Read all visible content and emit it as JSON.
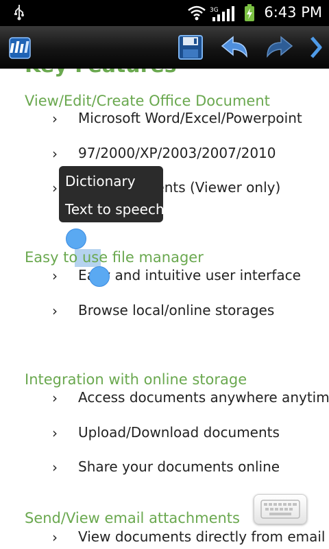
{
  "status_bar": {
    "time": "6:43 PM"
  },
  "toolbar": {
    "app_icon": "office-app-icon",
    "save_icon": "save-icon",
    "undo_icon": "undo-icon",
    "redo_icon": "redo-icon",
    "more_icon": "chevron-right-icon"
  },
  "document": {
    "top_heading_partial": "Key Features",
    "sections": [
      {
        "heading": "View/Edit/Create Office Document",
        "items": [
          "Microsoft Word/Excel/Powerpoint",
          "97/2000/XP/2003/2007/2010",
          "PDF documents (Viewer only)"
        ]
      },
      {
        "heading_before": "Easy to ",
        "heading_selected": "use",
        "heading_after": " file manager",
        "items": [
          "Easy and intuitive user interface",
          "Browse local/online storages"
        ]
      },
      {
        "heading": "Integration with online storage",
        "items": [
          "Access documents anywhere anytime",
          "Upload/Download documents",
          "Share your documents online"
        ]
      },
      {
        "heading": "Send/View email attachments",
        "items": [
          "View documents directly from email"
        ]
      }
    ],
    "bullet_char": "›"
  },
  "context_menu": {
    "options": [
      "Dictionary",
      "Text to speech"
    ]
  },
  "keyboard_icon": "keyboard-icon",
  "colors": {
    "heading": "#6aa84f",
    "selection": "#b5d3ef",
    "handle": "#5aa9f2"
  }
}
